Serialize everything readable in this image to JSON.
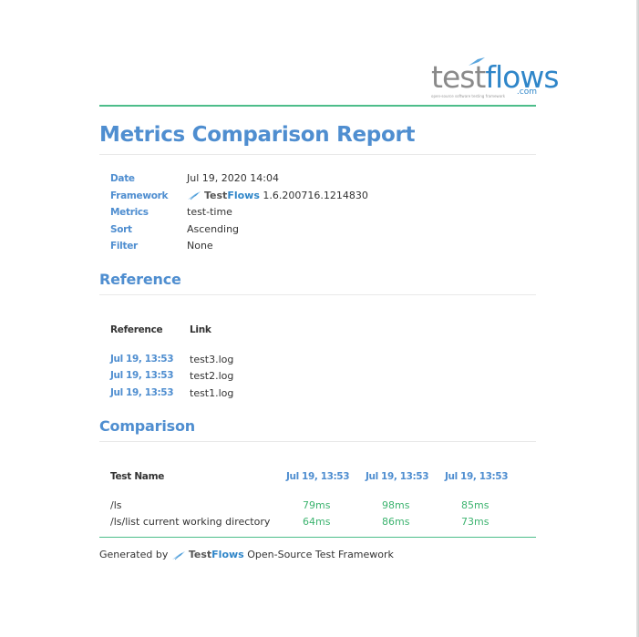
{
  "logo": {
    "word_test": "test",
    "word_flows": "flows",
    "com": ".com",
    "tagline": "open-source software testing framework"
  },
  "title": "Metrics Comparison Report",
  "meta": {
    "rows": [
      {
        "label": "Date",
        "value": "Jul 19, 2020 14:04"
      },
      {
        "label": "Framework",
        "brand_test": "Test",
        "brand_flows": "Flows",
        "value": "1.6.200716.1214830"
      },
      {
        "label": "Metrics",
        "value": "test-time"
      },
      {
        "label": "Sort",
        "value": "Ascending"
      },
      {
        "label": "Filter",
        "value": "None"
      }
    ]
  },
  "reference": {
    "title": "Reference",
    "headers": [
      "Reference",
      "Link"
    ],
    "rows": [
      {
        "date": "Jul 19, 13:53",
        "link": "test3.log"
      },
      {
        "date": "Jul 19, 13:53",
        "link": "test2.log"
      },
      {
        "date": "Jul 19, 13:53",
        "link": "test1.log"
      }
    ]
  },
  "comparison": {
    "title": "Comparison",
    "headers": [
      "Test Name",
      "Jul 19, 13:53",
      "Jul 19, 13:53",
      "Jul 19, 13:53"
    ],
    "rows": [
      {
        "name": "/ls",
        "values": [
          "79ms",
          "98ms",
          "85ms"
        ]
      },
      {
        "name": "/ls/list current working directory",
        "values": [
          "64ms",
          "86ms",
          "73ms"
        ]
      }
    ]
  },
  "footer": {
    "prefix": "Generated by",
    "brand_test": "Test",
    "brand_flows": "Flows",
    "suffix": "Open-Source Test Framework"
  },
  "colors": {
    "heading": "#4f8ed0",
    "rule": "#4dbd8a",
    "value_green": "#3cb36f",
    "brand_blue": "#2f86c9"
  },
  "icons": [
    "testflows-bird-icon"
  ]
}
